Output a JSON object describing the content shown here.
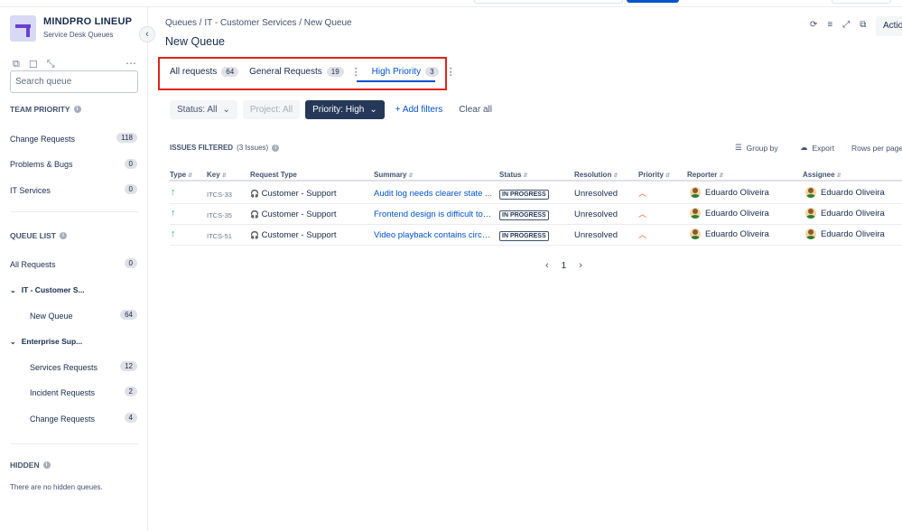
{
  "sidebar": {
    "app_name": "MINDPRO LINEUP",
    "app_sub": "Service Desk Queues",
    "search_placeholder": "Search queue",
    "team_priority_title": "TEAM PRIORITY",
    "team_priority": [
      {
        "label": "Change Requests",
        "count": "118"
      },
      {
        "label": "Problems & Bugs",
        "count": "0"
      },
      {
        "label": "IT Services",
        "count": "0"
      }
    ],
    "queue_list_title": "QUEUE LIST",
    "all_requests": {
      "label": "All Requests",
      "count": "0"
    },
    "group_it": "IT - Customer S...",
    "new_queue": {
      "label": "New Queue",
      "count": "64"
    },
    "group_ent": "Enterprise Sup...",
    "ent_items": [
      {
        "label": "Services Requests",
        "count": "12"
      },
      {
        "label": "Incident Requests",
        "count": "2"
      },
      {
        "label": "Change Requests",
        "count": "4"
      }
    ],
    "hidden_title": "HIDDEN",
    "hidden_text": "There are no hidden queues."
  },
  "header": {
    "breadcrumb": "Queues / IT - Customer Services / New Queue",
    "title": "New Queue",
    "actions_label": "Actio"
  },
  "tabs": [
    {
      "label": "All requests",
      "count": "64"
    },
    {
      "label": "General Requests",
      "count": "19"
    },
    {
      "label": "High Priority",
      "count": "3"
    }
  ],
  "filters": {
    "status": "Status: All",
    "project": "Project: All",
    "priority": "Priority: High",
    "add": "+ Add filters",
    "clear": "Clear all"
  },
  "issues": {
    "heading": "ISSUES FILTERED",
    "count_text": "(3 Issues)",
    "group_by": "Group by",
    "export": "Export",
    "rows_per_page": "Rows per page"
  },
  "table": {
    "columns": [
      "Type",
      "Key",
      "Request Type",
      "Summary",
      "Status",
      "Resolution",
      "Priority",
      "Reporter",
      "Assignee"
    ],
    "rows": [
      {
        "key": "ITCS-33",
        "request_type": "Customer - Support",
        "summary": "Audit log needs clearer state ...",
        "status": "IN PROGRESS",
        "resolution": "Unresolved",
        "reporter": "Eduardo Oliveira",
        "assignee": "Eduardo Oliveira"
      },
      {
        "key": "ITCS-35",
        "request_type": "Customer - Support",
        "summary": "Frontend design is difficult to l...",
        "status": "IN PROGRESS",
        "resolution": "Unresolved",
        "reporter": "Eduardo Oliveira",
        "assignee": "Eduardo Oliveira"
      },
      {
        "key": "ITCS-51",
        "request_type": "Customer - Support",
        "summary": "Video playback contains circul...",
        "status": "IN PROGRESS",
        "resolution": "Unresolved",
        "reporter": "Eduardo Oliveira",
        "assignee": "Eduardo Oliveira"
      }
    ]
  },
  "pagination": {
    "page": "1"
  },
  "colors": {
    "accent": "#0052cc",
    "highlight": "#e2231a",
    "dark_button": "#253858"
  }
}
